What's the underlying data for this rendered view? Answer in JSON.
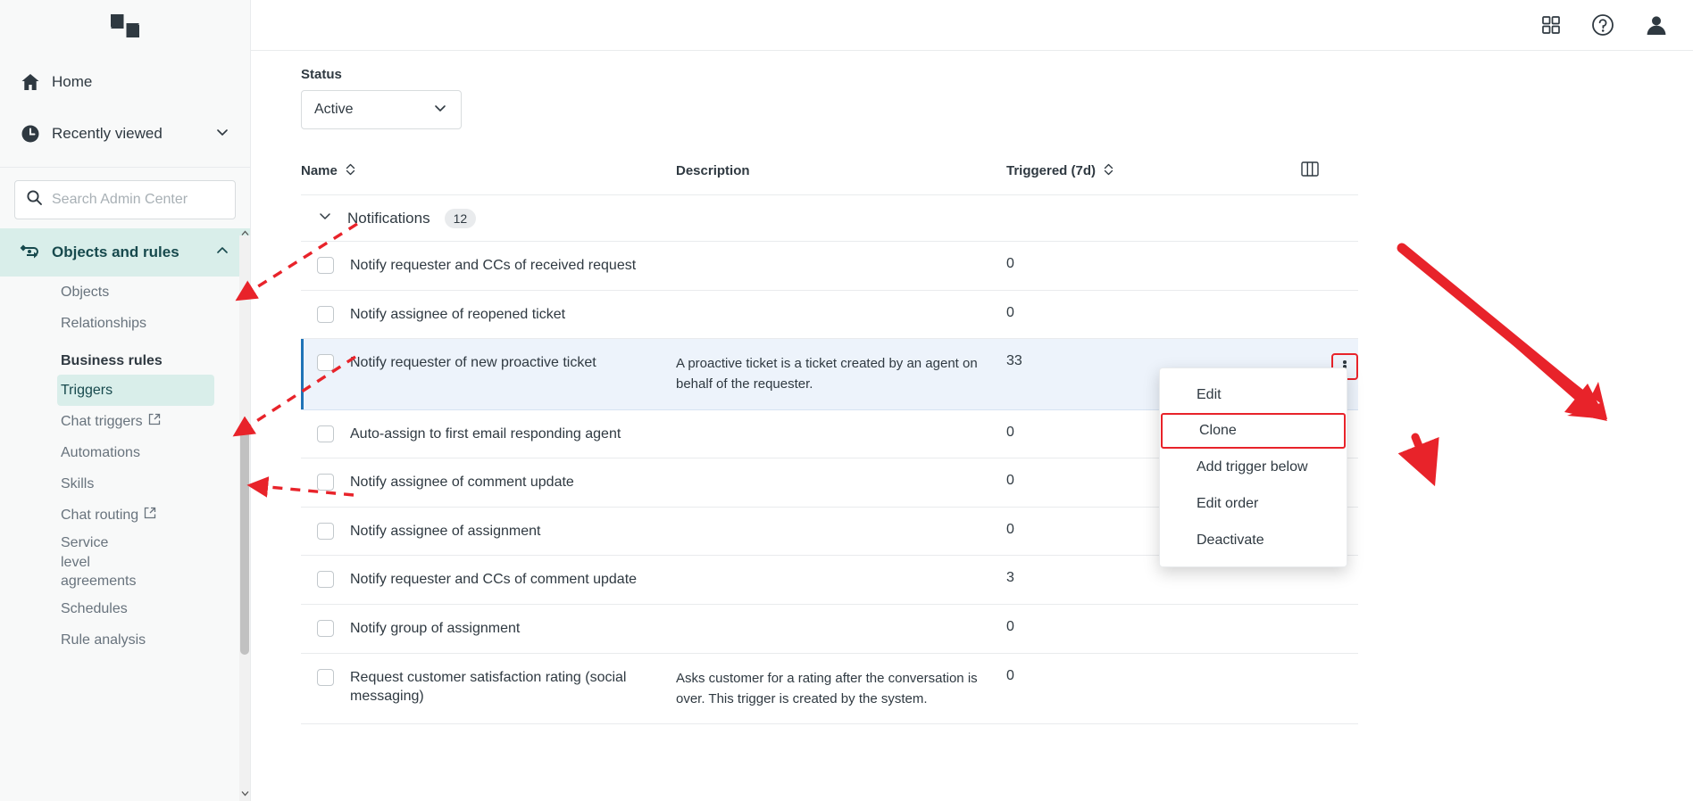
{
  "sidebar": {
    "logo": "zendesk-logo",
    "nav": [
      {
        "label": "Home",
        "icon": "home-icon"
      },
      {
        "label": "Recently viewed",
        "icon": "clock-icon",
        "chevron": "chevron-down-icon"
      }
    ],
    "search": {
      "placeholder": "Search Admin Center",
      "value": "",
      "icon": "search-icon"
    },
    "section": {
      "label": "Objects and rules",
      "icon": "objects-rules-icon",
      "chevron": "chevron-up-icon"
    },
    "items": [
      {
        "label": "Objects",
        "external": false,
        "active": false
      },
      {
        "label": "Relationships",
        "external": false,
        "active": false
      }
    ],
    "group_label": "Business rules",
    "rules_items": [
      {
        "label": "Triggers",
        "external": false,
        "active": true
      },
      {
        "label": "Chat triggers",
        "external": true,
        "active": false
      },
      {
        "label": "Automations",
        "external": false,
        "active": false
      },
      {
        "label": "Skills",
        "external": false,
        "active": false
      },
      {
        "label": "Chat routing",
        "external": true,
        "active": false
      },
      {
        "label": "Service level agreements",
        "external": false,
        "active": false
      },
      {
        "label": "Schedules",
        "external": false,
        "active": false
      },
      {
        "label": "Rule analysis",
        "external": false,
        "active": false
      }
    ]
  },
  "topbar": {
    "apps_icon": "grid-apps-icon",
    "help_icon": "help-circle-icon",
    "profile_icon": "user-avatar-icon"
  },
  "filter": {
    "label": "Status",
    "value": "Active",
    "chevron": "chevron-down-icon"
  },
  "table": {
    "headers": {
      "name": "Name",
      "description": "Description",
      "triggered": "Triggered (7d)",
      "columns_icon": "columns-settings-icon"
    },
    "group": {
      "name": "Notifications",
      "count": "12",
      "chevron": "chevron-down-icon"
    },
    "rows": [
      {
        "name": "Notify requester and CCs of received request",
        "description": "",
        "triggered": "0",
        "selected": false
      },
      {
        "name": "Notify assignee of reopened ticket",
        "description": "",
        "triggered": "0",
        "selected": false
      },
      {
        "name": "Notify requester of new proactive ticket",
        "description": "A proactive ticket is a ticket created by an agent on behalf of the requester.",
        "triggered": "33",
        "selected": true
      },
      {
        "name": "Auto-assign to first email responding agent",
        "description": "",
        "triggered": "0",
        "selected": false
      },
      {
        "name": "Notify assignee of comment update",
        "description": "",
        "triggered": "0",
        "selected": false
      },
      {
        "name": "Notify assignee of assignment",
        "description": "",
        "triggered": "0",
        "selected": false
      },
      {
        "name": "Notify requester and CCs of comment update",
        "description": "",
        "triggered": "3",
        "selected": false
      },
      {
        "name": "Notify group of assignment",
        "description": "",
        "triggered": "0",
        "selected": false
      },
      {
        "name": "Request customer satisfaction rating (social messaging)",
        "description": "Asks customer for a rating after the conversation is over. This trigger is created by the system.",
        "triggered": "0",
        "selected": false
      }
    ]
  },
  "row_menu": {
    "items": [
      {
        "label": "Edit",
        "marked": false
      },
      {
        "label": "Clone",
        "marked": true
      },
      {
        "label": "Add trigger below",
        "marked": false
      },
      {
        "label": "Edit order",
        "marked": false
      },
      {
        "label": "Deactivate",
        "marked": false
      }
    ]
  },
  "annotations": {
    "color": "#e8232a"
  }
}
